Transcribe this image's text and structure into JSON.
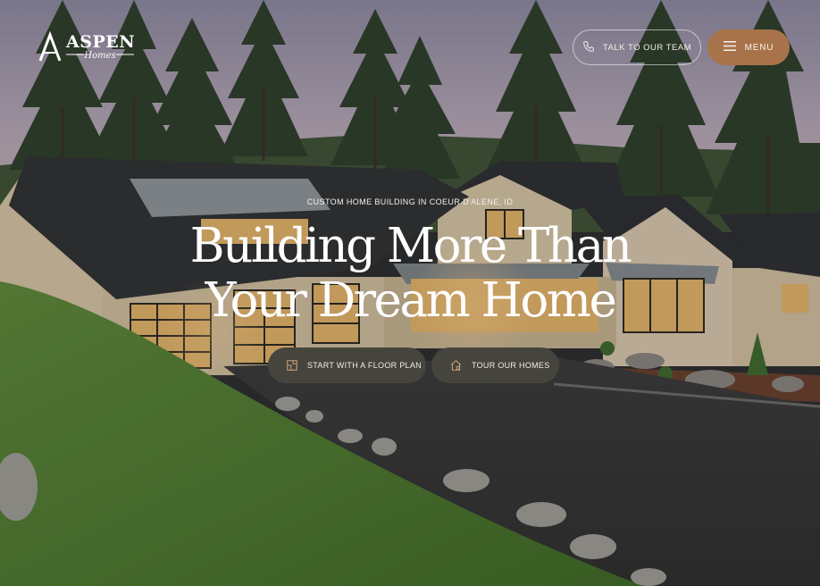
{
  "brand": {
    "name": "ASPEN",
    "tagline": "Homes"
  },
  "header": {
    "talk_label": "TALK TO OUR TEAM",
    "menu_label": "MENU"
  },
  "hero": {
    "eyebrow": "CUSTOM HOME BUILDING IN COEUR D'ALENE, ID",
    "headline_line1": "Building More Than",
    "headline_line2": "Your Dream Home",
    "cta_floor_plan": "START WITH A FLOOR PLAN",
    "cta_tour": "TOUR OUR HOMES"
  },
  "colors": {
    "accent": "#a8734a",
    "cta_bg": "#45443d"
  },
  "icons": {
    "talk": "phone-icon",
    "menu": "hamburger-icon",
    "floor_plan": "floor-plan-icon",
    "tour": "house-icon"
  }
}
